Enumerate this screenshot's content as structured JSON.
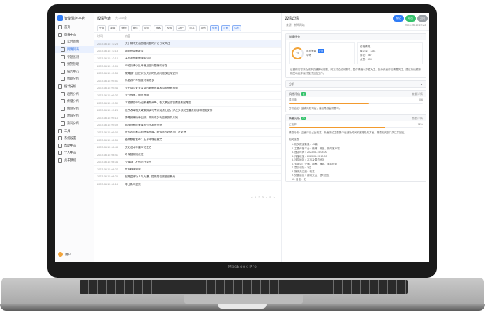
{
  "laptop": {
    "brand": "MacBook Pro"
  },
  "app": {
    "title": "智能监控平台",
    "nav": [
      {
        "label": "首页",
        "level": 0
      },
      {
        "label": "舆情中心",
        "level": 0
      },
      {
        "label": "实时舆情",
        "level": 1
      },
      {
        "label": "舆情列表",
        "level": 1,
        "active": true
      },
      {
        "label": "专题监测",
        "level": 1
      },
      {
        "label": "预警管理",
        "level": 1
      },
      {
        "label": "报告中心",
        "level": 1
      },
      {
        "label": "数据分析",
        "level": 1
      },
      {
        "label": "统计分析",
        "level": 0
      },
      {
        "label": "趋势分析",
        "level": 1
      },
      {
        "label": "传播分析",
        "level": 1
      },
      {
        "label": "情感分析",
        "level": 1
      },
      {
        "label": "地域分析",
        "level": 1
      },
      {
        "label": "热词分析",
        "level": 1
      },
      {
        "label": "工具",
        "level": 0
      },
      {
        "label": "系统设置",
        "level": 0
      },
      {
        "label": "帮助中心",
        "level": 0
      },
      {
        "label": "个人中心",
        "level": 0
      },
      {
        "label": "关于我们",
        "level": 0
      }
    ],
    "user": "用户"
  },
  "list": {
    "title": "舆情列表",
    "count": "共1234条",
    "filters": [
      "全部",
      "新闻",
      "微博",
      "微信",
      "论坛",
      "博客",
      "视频",
      "APP",
      "问答",
      "其他"
    ],
    "active_filters": [
      "负面",
      "正面",
      "中性"
    ],
    "columns": {
      "time": "时间",
      "content": "内容"
    },
    "rows": [
      {
        "time": "2023-06-15 10:23",
        "content": "关于城市交通拥堵问题的讨论引发关注"
      },
      {
        "time": "2023-06-15 10:18",
        "content": "网友热议新政策"
      },
      {
        "time": "2023-06-15 10:12",
        "content": "某地发布最新通知公告"
      },
      {
        "time": "2023-06-15 10:05",
        "content": "市民反映小区环境卫生问题持续存在"
      },
      {
        "time": "2023-06-15 09:58",
        "content": "教育部门回应家长关切的热点问题及后续安排"
      },
      {
        "time": "2023-06-15 09:51",
        "content": "新能源汽车销量持续增长"
      },
      {
        "time": "2023-06-15 09:44",
        "content": "关于食品安全监管的最新进展和相关措施报道"
      },
      {
        "time": "2023-06-15 09:37",
        "content": "天气预报：明日有雨"
      },
      {
        "time": "2023-06-15 09:30",
        "content": "本地旅游市场迎来暑期高峰，各大景区游客数量明显增加"
      },
      {
        "time": "2023-06-15 09:23",
        "content": "医疗改革相关政策解读与专家观点汇总，涉及多项民生重点内容和措施安排"
      },
      {
        "time": "2023-06-15 09:16",
        "content": "体育赛事精彩回顾，本周末多场比赛即将开始"
      },
      {
        "time": "2023-06-15 09:09",
        "content": "科技创新成果展示会在本市举办"
      },
      {
        "time": "2023-06-15 09:02",
        "content": "社区志愿者活动持续开展，获得居民好评与广泛支持"
      },
      {
        "time": "2023-06-15 08:55",
        "content": "经济数据发布：上半年增长稳定"
      },
      {
        "time": "2023-06-15 08:48",
        "content": "文化活动丰富市民生活"
      },
      {
        "time": "2023-06-15 08:41",
        "content": "环保督察组进驻"
      },
      {
        "time": "2023-06-15 08:34",
        "content": "交通部门发布出行提示"
      },
      {
        "time": "2023-06-15 08:27",
        "content": "住房政策调整"
      },
      {
        "time": "2023-06-15 08:20",
        "content": "招聘会现场人气火爆，提供岗位数量创新高"
      },
      {
        "time": "2023-06-15 08:13",
        "content": "每日新闻速览"
      }
    ],
    "pager": "< 1 2 3 4 5 >"
  },
  "detail": {
    "title": "舆情详情",
    "buttons": [
      {
        "label": "标记",
        "color": "#2f7cf6"
      },
      {
        "label": "导出",
        "color": "#34c26b"
      },
      {
        "label": "关闭",
        "color": "#9aa0a6"
      }
    ],
    "meta_left": "来源：新闻网站",
    "meta_right": "2023-06-15 10:23",
    "section_score": "舆情评分",
    "score_value": "75",
    "score_label_a": "风险等级",
    "score_label_b": "中等",
    "score_tag": "正常",
    "side_title": "传播情况",
    "side_lines": [
      "转发量：1234",
      "评论：567",
      "点赞：890"
    ],
    "summary": "该舆情内容涉及城市交通拥堵问题，网友讨论较为集中，整体情绪以中性为主，部分负面评论需要关注，建议持续跟踪相关动态并及时做好回应工作。",
    "section_analysis": "分析",
    "block1_title": "风险评估",
    "block1_tag": "低",
    "block1_right": "查看详情",
    "block1_bar_label": "风险值",
    "block1_bar_value": "0.6",
    "block1_fill": 0.6,
    "block1_note": "分析结论：整体风险可控，建议常规监测即可。",
    "block2_title": "情感分析",
    "block2_tag": "中",
    "block2_right": "查看详情",
    "block2_bar_label": "正面率",
    "block2_bar_value": "72%",
    "block2_fill": 0.72,
    "block2_note": "情感分布：正面评论占比较高，负面评论主要集中在通勤时间和道路规划方面，需要相关部门关注并回应。",
    "list_title": "相关信息",
    "list_lines": [
      "1. 相关报道数量：45篇",
      "2. 主要传播平台：微博、微信、新闻客户端",
      "3. 首发时间：2023-06-15 08:00",
      "4. 传播峰值：2023-06-15 10:00",
      "5. 涉及地区：本市及周边地区",
      "6. 关键词：交通、拥堵、通勤、道路规划",
      "7. 意见领袖：3位",
      "8. 媒体关注度：较高",
      "9. 处置建议：持续关注，适时回应",
      "10. 备注：无"
    ]
  }
}
